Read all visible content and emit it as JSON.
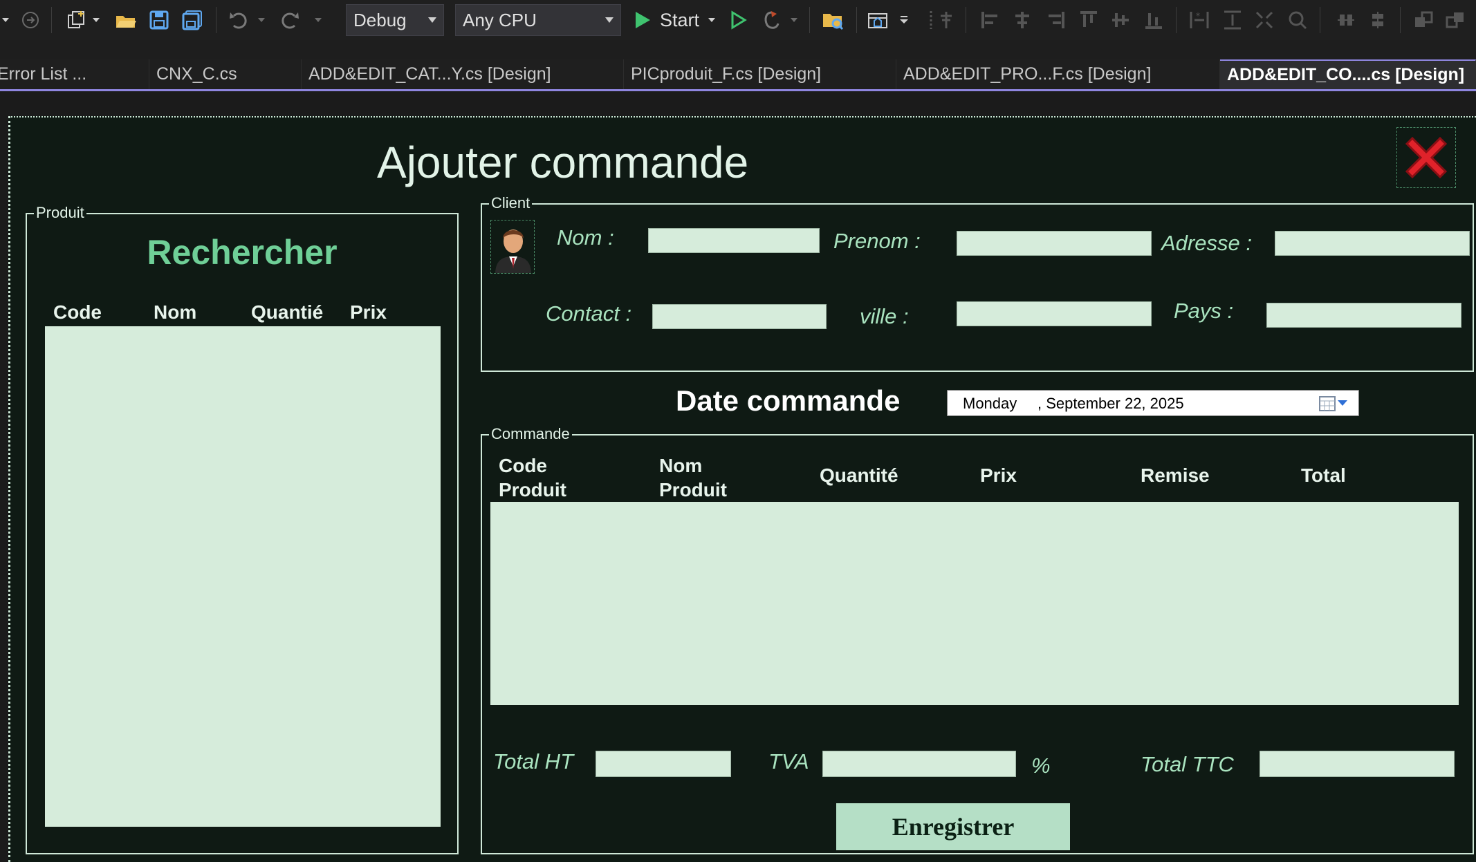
{
  "toolbar": {
    "configuration": "Debug",
    "platform": "Any CPU",
    "start_label": "Start",
    "icons": [
      "back-icon",
      "forward-icon",
      "new-project-icon",
      "open-folder-icon",
      "save-icon",
      "save-all-icon",
      "undo-icon",
      "redo-icon",
      "start-icon",
      "start-without-debug-icon",
      "hot-reload-icon",
      "solution-explorer-icon",
      "toolbox-icon",
      "align-icons"
    ]
  },
  "tabs": [
    {
      "label": "Error List ..."
    },
    {
      "label": "CNX_C.cs"
    },
    {
      "label": "ADD&EDIT_CAT...Y.cs [Design]"
    },
    {
      "label": "PICproduit_F.cs [Design]"
    },
    {
      "label": "ADD&EDIT_PRO...F.cs [Design]"
    },
    {
      "label": "ADD&EDIT_CO....cs [Design]"
    }
  ],
  "form": {
    "title": "Ajouter commande",
    "produit_group": {
      "caption": "Produit",
      "search_label": "Rechercher",
      "columns": [
        "Code",
        "Nom",
        "Quantié",
        "Prix"
      ]
    },
    "client_group": {
      "caption": "Client",
      "labels": {
        "nom": "Nom :",
        "prenom": "Prenom :",
        "adresse": "Adresse :",
        "contact": "Contact :",
        "ville": "ville :",
        "pays": "Pays :"
      }
    },
    "date": {
      "label": "Date commande",
      "day": "Monday",
      "date": ", September 22, 2025"
    },
    "commande_group": {
      "caption": "Commande",
      "columns": [
        {
          "line1": "Code",
          "line2": "Produit"
        },
        {
          "line1": "Nom",
          "line2": "Produit"
        },
        {
          "line1": "Quantité",
          "line2": ""
        },
        {
          "line1": "Prix",
          "line2": ""
        },
        {
          "line1": "Remise",
          "line2": ""
        },
        {
          "line1": "Total",
          "line2": ""
        }
      ]
    },
    "totals": {
      "total_ht": "Total HT",
      "tva": "TVA",
      "percent": "%",
      "total_ttc": "Total TTC"
    },
    "save_button": "Enregistrer"
  },
  "colors": {
    "form_bg": "#0f1a14",
    "field_bg": "#d6ecdb",
    "label_green": "#a9e3bf",
    "accent_green": "#6fcf97",
    "tab_underline": "#8f86e0"
  }
}
